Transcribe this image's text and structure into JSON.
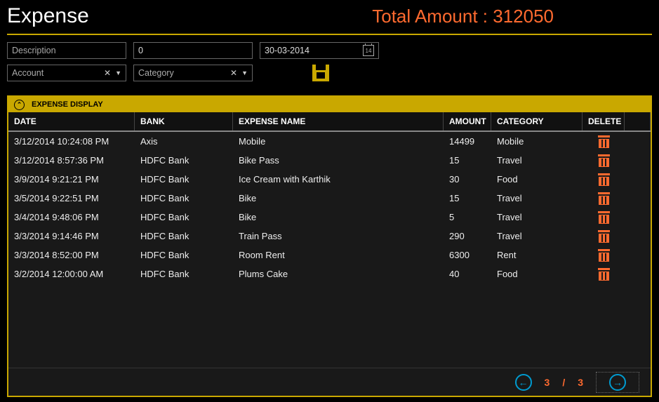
{
  "header": {
    "title": "Expense",
    "total_label": "Total Amount : 312050"
  },
  "filters": {
    "description_placeholder": "Description",
    "amount_value": "0",
    "date_value": "30-03-2014",
    "account_placeholder": "Account",
    "category_placeholder": "Category",
    "calendar_day": "14"
  },
  "panel": {
    "title": "EXPENSE DISPLAY"
  },
  "columns": {
    "date": "DATE",
    "bank": "BANK",
    "name": "EXPENSE NAME",
    "amount": "AMOUNT",
    "category": "CATEGORY",
    "delete": "DELETE"
  },
  "rows": [
    {
      "date": "3/12/2014 10:24:08 PM",
      "bank": "Axis",
      "name": "Mobile",
      "amount": "14499",
      "category": "Mobile"
    },
    {
      "date": "3/12/2014 8:57:36 PM",
      "bank": "HDFC Bank",
      "name": "Bike Pass",
      "amount": "15",
      "category": "Travel"
    },
    {
      "date": "3/9/2014 9:21:21 PM",
      "bank": "HDFC Bank",
      "name": "Ice Cream with Karthik",
      "amount": "30",
      "category": "Food"
    },
    {
      "date": "3/5/2014 9:22:51 PM",
      "bank": "HDFC Bank",
      "name": "Bike",
      "amount": "15",
      "category": "Travel"
    },
    {
      "date": "3/4/2014 9:48:06 PM",
      "bank": "HDFC Bank",
      "name": "Bike",
      "amount": "5",
      "category": "Travel"
    },
    {
      "date": "3/3/2014 9:14:46 PM",
      "bank": "HDFC Bank",
      "name": "Train Pass",
      "amount": "290",
      "category": "Travel"
    },
    {
      "date": "3/3/2014 8:52:00 PM",
      "bank": "HDFC Bank",
      "name": "Room Rent",
      "amount": "6300",
      "category": "Rent"
    },
    {
      "date": "3/2/2014 12:00:00 AM",
      "bank": "HDFC Bank",
      "name": "Plums Cake",
      "amount": "40",
      "category": "Food"
    }
  ],
  "pager": {
    "current": "3",
    "sep": "/",
    "total": "3"
  }
}
